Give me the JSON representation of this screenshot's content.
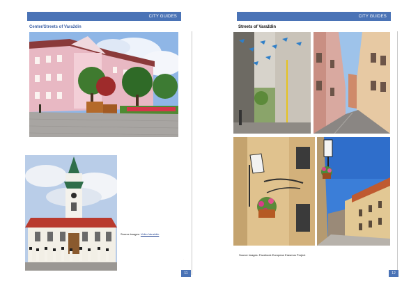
{
  "pages": [
    {
      "header": "CITY GUIDES",
      "title": "Center/Streets of Varaždin",
      "photos": [
        {
          "icon": "photo-pink-palace-square"
        },
        {
          "icon": "photo-town-hall-tower"
        }
      ],
      "caption": {
        "prefix": "Source images:",
        "link": "Volim Varaždin"
      },
      "page_number": "11"
    },
    {
      "header": "CITY GUIDES",
      "title": "Streets of Varaždin",
      "photos": [
        {
          "icon": "photo-umbrella-wall"
        },
        {
          "icon": "photo-narrow-street"
        },
        {
          "icon": "photo-street-lamp-flowers"
        },
        {
          "icon": "photo-sunny-street-lamp"
        }
      ],
      "caption": {
        "prefix": "Source images: Facebook European Erasmus Project"
      },
      "page_number": "12"
    }
  ],
  "colors": {
    "accent": "#4a73b6",
    "title_blue": "#3f63a6"
  }
}
